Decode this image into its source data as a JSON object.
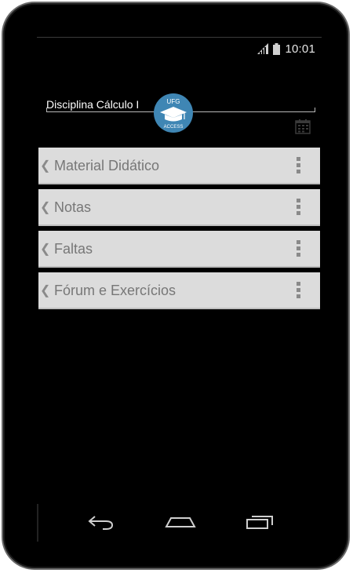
{
  "status_bar": {
    "time": "10:01",
    "icons": [
      "signal-icon",
      "battery-icon"
    ]
  },
  "header": {
    "title": "Disciplina Cálculo I",
    "logo_top": "UFG",
    "logo_bottom": "ACCESS",
    "calendar_icon": "calendar-icon"
  },
  "menu": [
    {
      "label": "Material Didático"
    },
    {
      "label": "Notas"
    },
    {
      "label": "Faltas"
    },
    {
      "label": "Fórum e Exercícios"
    }
  ],
  "navbar": {
    "icons": [
      "back-icon",
      "home-icon",
      "recent-apps-icon"
    ]
  },
  "colors": {
    "screen_bg": "#000000",
    "menu_item_bg": "#dcdcdc",
    "menu_text": "#777777",
    "logo_blue": "#3f86b4"
  }
}
